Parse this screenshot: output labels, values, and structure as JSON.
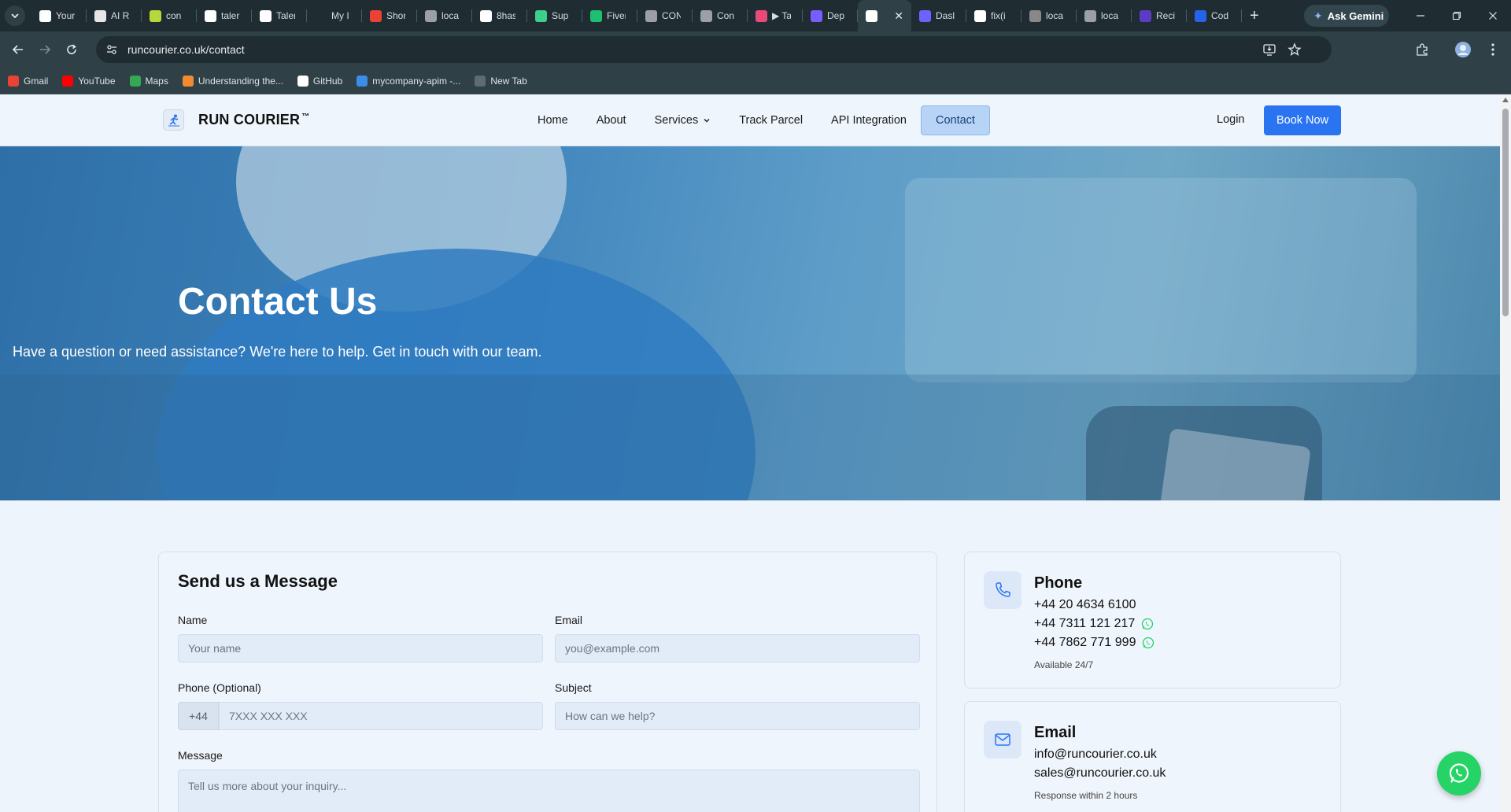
{
  "browser": {
    "tabs": [
      {
        "label": "Your",
        "color": "#ffffff"
      },
      {
        "label": "AI R",
        "color": "#e6e6e6"
      },
      {
        "label": "con",
        "color": "#b7d83a"
      },
      {
        "label": "taler",
        "color": "#ffffff"
      },
      {
        "label": "Taler",
        "color": "#ffffff"
      },
      {
        "label": "My I",
        "color": "#1f2d33"
      },
      {
        "label": "Shor",
        "color": "#ea4335"
      },
      {
        "label": "loca",
        "color": "#9aa0a6"
      },
      {
        "label": "8has",
        "color": "#ffffff"
      },
      {
        "label": "Sup",
        "color": "#3ecf8e"
      },
      {
        "label": "Fiver",
        "color": "#1dbf73"
      },
      {
        "label": "CON",
        "color": "#9aa0a6"
      },
      {
        "label": "Con",
        "color": "#9aa0a6"
      },
      {
        "label": "▶ Ta",
        "color": "#e94a7a"
      },
      {
        "label": "Dep",
        "color": "#7b5cff"
      },
      {
        "label": "",
        "color": "#ffffff",
        "active": true
      },
      {
        "label": "Dasl",
        "color": "#6c63ff"
      },
      {
        "label": "fix(i",
        "color": "#ffffff"
      },
      {
        "label": "loca",
        "color": "#888888"
      },
      {
        "label": "loca",
        "color": "#9aa0a6"
      },
      {
        "label": "Reci",
        "color": "#5b3cc4"
      },
      {
        "label": "Cod",
        "color": "#2563eb"
      }
    ],
    "gemini_label": "Ask Gemini",
    "url": "runcourier.co.uk/contact",
    "bookmarks": [
      {
        "label": "Gmail",
        "icon": "gmail-icon",
        "color": "#ea4335"
      },
      {
        "label": "YouTube",
        "icon": "youtube-icon",
        "color": "#ff0000"
      },
      {
        "label": "Maps",
        "icon": "maps-icon",
        "color": "#34a853"
      },
      {
        "label": "Understanding the...",
        "icon": "page-icon",
        "color": "#f28b30"
      },
      {
        "label": "GitHub",
        "icon": "github-icon",
        "color": "#ffffff"
      },
      {
        "label": "mycompany-apim -...",
        "icon": "azure-icon",
        "color": "#3a8ee6"
      },
      {
        "label": "New Tab",
        "icon": "newtab-icon",
        "color": "#5f6b70"
      }
    ]
  },
  "site": {
    "brand": "RUN COURIER",
    "trademark": "™",
    "nav": [
      {
        "label": "Home",
        "name": "nav-home"
      },
      {
        "label": "About",
        "name": "nav-about"
      },
      {
        "label": "Services",
        "name": "nav-services",
        "dropdown": true
      },
      {
        "label": "Track Parcel",
        "name": "nav-track-parcel"
      },
      {
        "label": "API Integration",
        "name": "nav-api-integration"
      },
      {
        "label": "Contact",
        "name": "nav-contact",
        "active": true
      }
    ],
    "login_label": "Login",
    "book_label": "Book Now",
    "accent": "#2a74f2"
  },
  "hero": {
    "title": "Contact Us",
    "subtitle": "Have a question or need assistance? We're here to help. Get in touch with our team."
  },
  "form": {
    "title": "Send us a Message",
    "name_label": "Name",
    "name_placeholder": "Your name",
    "email_label": "Email",
    "email_placeholder": "you@example.com",
    "phone_label": "Phone (Optional)",
    "phone_prefix": "+44",
    "phone_placeholder": "7XXX XXX XXX",
    "subject_label": "Subject",
    "subject_placeholder": "How can we help?",
    "message_label": "Message",
    "message_placeholder": "Tell us more about your inquiry..."
  },
  "contact": {
    "phone": {
      "title": "Phone",
      "lines": [
        "+44 20 4634 6100",
        "+44 7311 121 217",
        "+44 7862 771 999"
      ],
      "note": "Available 24/7"
    },
    "email": {
      "title": "Email",
      "lines": [
        "info@runcourier.co.uk",
        "sales@runcourier.co.uk"
      ],
      "note": "Response within 2 hours"
    }
  }
}
